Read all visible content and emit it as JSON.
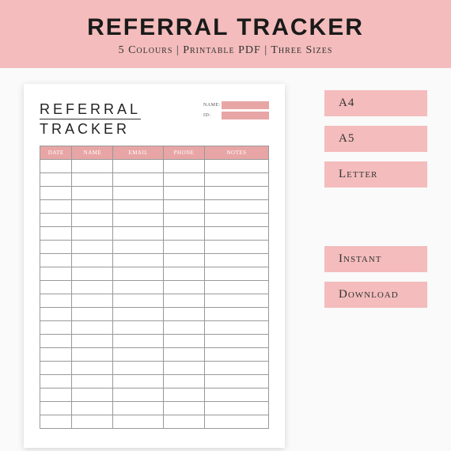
{
  "header": {
    "title": "REFERRAL TRACKER",
    "subtitle": "5 Colours | Printable PDF | Three Sizes"
  },
  "preview": {
    "title_line1": "REFERRAL",
    "title_line2": "TRACKER",
    "meta": {
      "name_label": "NAME:",
      "id_label": "ID:"
    },
    "columns": [
      "DATE",
      "NAME",
      "EMAIL",
      "PHONE",
      "NOTES"
    ],
    "row_count": 20
  },
  "sidebar": {
    "sizes": [
      "A4",
      "A5",
      "Letter"
    ],
    "badges": [
      "Instant",
      "Download"
    ]
  },
  "colors": {
    "pink": "#f4bcbc",
    "pink_dark": "#e8a5a5"
  }
}
